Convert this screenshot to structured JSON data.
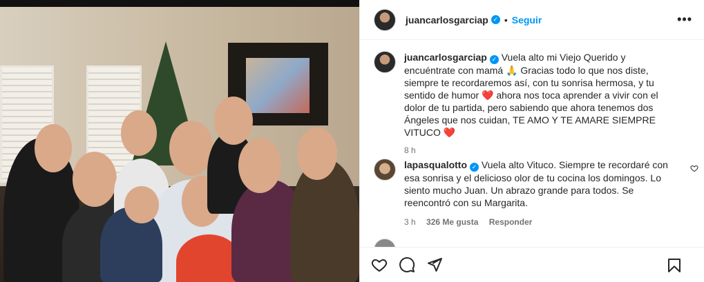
{
  "header": {
    "username": "juancarlosgarciap",
    "follow_label": "Seguir",
    "separator": "•",
    "more_label": "•••"
  },
  "caption": {
    "username": "juancarlosgarciap",
    "text": "Vuela alto mi Viejo Querido y encuéntrate con mamá 🙏 Gracias todo lo que nos diste, siempre te recordaremos así, con tu sonrisa hermosa, y tu sentido de humor ❤️ ahora nos toca aprender a vivir con el dolor de tu partida, pero sabiendo que ahora tenemos dos Ángeles que nos cuidan, TE AMO Y TE AMARE SIEMPRE VITUCO ❤️",
    "time": "8 h"
  },
  "comments": [
    {
      "username": "lapasqualotto",
      "text": "Vuela alto Vituco. Siempre te recordaré con esa sonrisa y el delicioso olor de tu cocina los domingos. Lo siento mucho Juan. Un abrazo grande para todos. Se reencontró con su Margarita.",
      "time": "3 h",
      "likes": "326 Me gusta",
      "reply_label": "Responder"
    }
  ],
  "icons": {
    "like": "heart-icon",
    "comment": "comment-icon",
    "share": "share-icon",
    "save": "bookmark-icon",
    "verified": "verified-badge-icon"
  },
  "colors": {
    "accent": "#0095f6",
    "heart": "#ed4956",
    "text": "#262626",
    "muted": "#737373"
  }
}
